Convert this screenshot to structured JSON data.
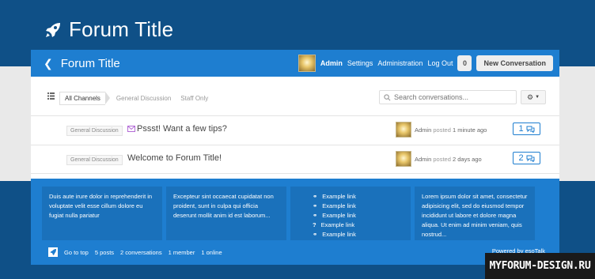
{
  "site": {
    "title": "Forum Title"
  },
  "topbar": {
    "title": "Forum Title",
    "user": "Admin",
    "links": [
      "Settings",
      "Administration",
      "Log Out"
    ],
    "notification_count": "0",
    "new_conversation": "New Conversation"
  },
  "toolbar": {
    "channels": [
      "All Channels",
      "General Discussion",
      "Staff Only"
    ],
    "search_placeholder": "Search conversations..."
  },
  "conversations": [
    {
      "channel": "General Discussion",
      "title": "Pssst! Want a few tips?",
      "author": "Admin",
      "posted": "posted",
      "time": "1 minute ago",
      "replies": "1"
    },
    {
      "channel": "General Discussion",
      "title": "Welcome to Forum Title!",
      "author": "Admin",
      "posted": "posted",
      "time": "2 days ago",
      "replies": "2"
    }
  ],
  "footer": {
    "col1": "Duis aute irure dolor in reprehenderit in voluptate velit esse cillum dolore eu fugiat nulla pariatur",
    "col2": "Excepteur sint occaecat cupidatat non proident, sunt in culpa qui officia deserunt mollit anim id est laborum...",
    "col3": [
      "Example link",
      "Example link",
      "Example link",
      "Example link",
      "Example link"
    ],
    "col4": "Lorem ipsum dolor sit amet, consectetur adipisicing elit, sed do eiusmod tempor incididunt ut labore et dolore magna aliqua. Ut enim ad minim veniam, quis nostrud...",
    "stats": [
      "Go to top",
      "5 posts",
      "2 conversations",
      "1 member",
      "1 online"
    ],
    "powered": "Powered by esoTalk"
  },
  "watermark": "MYFORUM-DESIGN.RU",
  "colors": {
    "dark_blue": "#0f5087",
    "accent_blue": "#1e7ed0"
  }
}
